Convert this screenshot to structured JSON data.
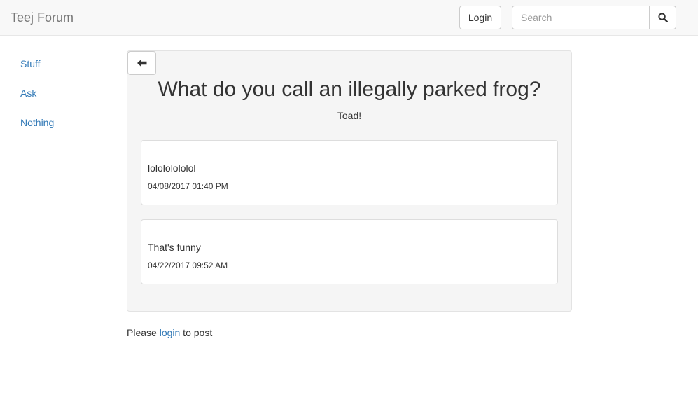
{
  "navbar": {
    "brand": "Teej Forum",
    "login_label": "Login",
    "search_placeholder": "Search",
    "search_icon": "magnifier-icon"
  },
  "sidebar": {
    "items": [
      {
        "label": "Stuff"
      },
      {
        "label": "Ask"
      },
      {
        "label": "Nothing"
      }
    ]
  },
  "post": {
    "back_icon": "arrow-left-icon",
    "title": "What do you call an illegally parked frog?",
    "body": "Toad!",
    "replies": [
      {
        "text": "lolololololol",
        "date": "04/08/2017 01:40 PM"
      },
      {
        "text": "That's funny",
        "date": "04/22/2017 09:52 AM"
      }
    ]
  },
  "footer": {
    "prefix": "Please ",
    "link": "login",
    "suffix": " to post"
  },
  "colors": {
    "link": "#337ab7",
    "navbar_bg": "#f8f8f8",
    "well_bg": "#f5f5f5"
  }
}
